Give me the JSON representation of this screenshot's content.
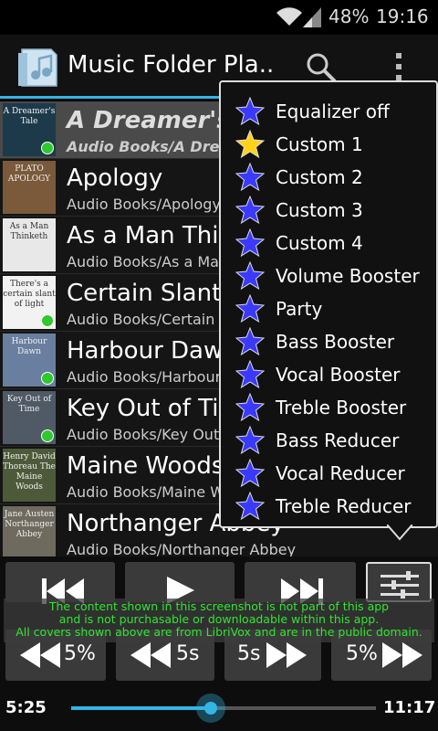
{
  "status": {
    "battery": "48%",
    "time": "19:16"
  },
  "action_bar": {
    "title": "Music Folder Pla...",
    "icons": [
      "app-folder-icon",
      "search-icon",
      "overflow-menu-icon"
    ]
  },
  "tracks": [
    {
      "title": "A Dreamer's Tale",
      "path": "Audio Books/A Dreamer's Tale",
      "cover_text": "A Dreamer's Tale",
      "cover_bg": "#1d3a4a",
      "playing": true
    },
    {
      "title": "Apology",
      "path": "Audio Books/Apology",
      "cover_text": "PLATO APOLOGY",
      "cover_bg": "#7a5a3a",
      "playing": false
    },
    {
      "title": "As a Man Thinketh",
      "path": "Audio Books/As a Man Thinketh",
      "cover_text": "As a Man Thinketh",
      "cover_bg": "#e8e8e8",
      "playing": false
    },
    {
      "title": "Certain Slant of Light",
      "path": "Audio Books/Certain Slant of Light",
      "cover_text": "There's a certain slant of light",
      "cover_bg": "#f2f2f2",
      "playing": true
    },
    {
      "title": "Harbour Dawn",
      "path": "Audio Books/Harbour Dawn",
      "cover_text": "Harbour Dawn",
      "cover_bg": "#6a7fa0",
      "playing": true
    },
    {
      "title": "Key Out of Time",
      "path": "Audio Books/Key Out of Time",
      "cover_text": "Key Out of Time",
      "cover_bg": "#4f5a66",
      "playing": true
    },
    {
      "title": "Maine Woods",
      "path": "Audio Books/Maine Woods",
      "cover_text": "Henry David Thoreau The Maine Woods",
      "cover_bg": "#4d5a3a",
      "playing": false
    },
    {
      "title": "Northanger Abbey",
      "path": "Audio Books/Northanger Abbey",
      "cover_text": "Jane Austen Northanger Abbey",
      "cover_bg": "#6e6a5e",
      "playing": false
    }
  ],
  "popup_menu": {
    "items": [
      {
        "label": "Equalizer off",
        "selected": false
      },
      {
        "label": "Custom 1",
        "selected": true
      },
      {
        "label": "Custom 2",
        "selected": false
      },
      {
        "label": "Custom 3",
        "selected": false
      },
      {
        "label": "Custom 4",
        "selected": false
      },
      {
        "label": "Volume Booster",
        "selected": false
      },
      {
        "label": "Party",
        "selected": false
      },
      {
        "label": "Bass Booster",
        "selected": false
      },
      {
        "label": "Vocal Booster",
        "selected": false
      },
      {
        "label": "Treble Booster",
        "selected": false
      },
      {
        "label": "Bass Reducer",
        "selected": false
      },
      {
        "label": "Vocal Reducer",
        "selected": false
      },
      {
        "label": "Treble Reducer",
        "selected": false
      }
    ],
    "star_color": "#3a3aff",
    "selected_star_color": "#ffd21a"
  },
  "controls": {
    "skip_back_pct": "5%",
    "skip_back_sec": "5s",
    "skip_fwd_sec": "5s",
    "skip_fwd_pct": "5%"
  },
  "notice": {
    "line1": "The content shown in this screenshot is not part of this app",
    "line2": "and is not purchasable or downloadable within this app.",
    "line3": "All covers shown above are from LibriVox and are in the public domain."
  },
  "seek": {
    "elapsed": "5:25",
    "total": "11:17",
    "progress": 0.4567
  },
  "colors": {
    "accent": "#33b5e5",
    "notice_text": "#2fe62f",
    "playing_dot": "#2fc82f"
  }
}
